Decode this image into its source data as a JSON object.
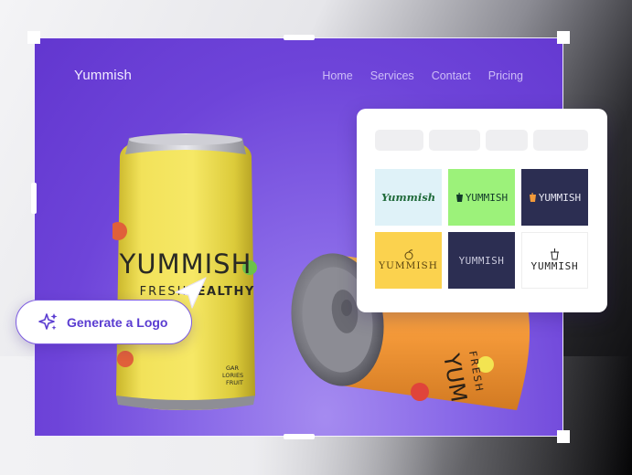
{
  "site": {
    "brand": "Yummish",
    "nav": [
      "Home",
      "Services",
      "Contact",
      "Pricing"
    ]
  },
  "product": {
    "yellow_can": {
      "brand": "YUMMISH",
      "tagline_a": "FRESH",
      "tagline_b": "HEALTHY",
      "small_lines": [
        "GAR",
        "LORIES",
        "FRUIT"
      ]
    },
    "orange_can": {
      "brand": "YUM",
      "tagline": "FRESH"
    }
  },
  "logo_panel": {
    "tiles": [
      {
        "text": "Yummish",
        "icon": ""
      },
      {
        "text": "YUMMISH",
        "icon": "cup-icon"
      },
      {
        "text": "YUMMISH",
        "icon": "cup-icon"
      },
      {
        "text": "YUMMISH",
        "icon": "leaf-icon"
      },
      {
        "text": "YUMMISH",
        "icon": ""
      },
      {
        "text": "YUMMISH",
        "icon": "cup-icon"
      }
    ]
  },
  "cta": {
    "label": "Generate a Logo",
    "icon": "sparkle-icon"
  },
  "colors": {
    "accent": "#5a3cd1",
    "canvas": "#6e44d9",
    "yellow_can": "#f3e451",
    "orange_can": "#f59a3a"
  }
}
